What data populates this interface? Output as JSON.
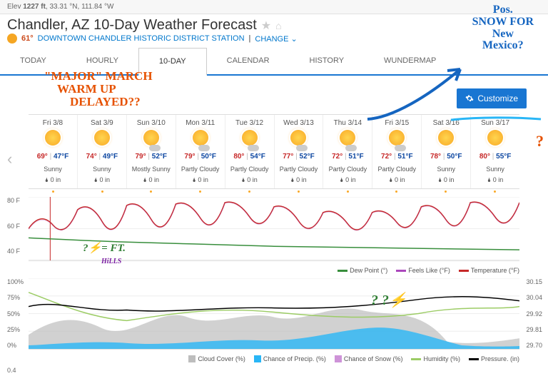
{
  "header": {
    "elev_label": "Elev",
    "elev": "1227 ft",
    "lat": "33.31 °N",
    "lon": "111.84 °W"
  },
  "title": "Chandler, AZ 10-Day Weather Forecast",
  "current": {
    "temp": "61°",
    "station": "DOWNTOWN CHANDLER HISTORIC DISTRICT STATION",
    "change": "CHANGE"
  },
  "tabs": [
    "TODAY",
    "HOURLY",
    "10-DAY",
    "CALENDAR",
    "HISTORY",
    "WUNDERMAP"
  ],
  "active_tab": 2,
  "customize": "Customize",
  "days": [
    {
      "label": "Fri 3/8",
      "hi": "69°",
      "lo": "47°F",
      "cond": "Sunny",
      "precip": "0 in",
      "cloud": false
    },
    {
      "label": "Sat 3/9",
      "hi": "74°",
      "lo": "49°F",
      "cond": "Sunny",
      "precip": "0 in",
      "cloud": false
    },
    {
      "label": "Sun 3/10",
      "hi": "79°",
      "lo": "52°F",
      "cond": "Mostly Sunny",
      "precip": "0 in",
      "cloud": true
    },
    {
      "label": "Mon 3/11",
      "hi": "79°",
      "lo": "50°F",
      "cond": "Partly Cloudy",
      "precip": "0 in",
      "cloud": true
    },
    {
      "label": "Tue 3/12",
      "hi": "80°",
      "lo": "54°F",
      "cond": "Partly Cloudy",
      "precip": "0 in",
      "cloud": true
    },
    {
      "label": "Wed 3/13",
      "hi": "77°",
      "lo": "52°F",
      "cond": "Partly Cloudy",
      "precip": "0 in",
      "cloud": true
    },
    {
      "label": "Thu 3/14",
      "hi": "72°",
      "lo": "51°F",
      "cond": "Partly Cloudy",
      "precip": "0 in",
      "cloud": true
    },
    {
      "label": "Fri 3/15",
      "hi": "72°",
      "lo": "51°F",
      "cond": "Partly Cloudy",
      "precip": "0 in",
      "cloud": true
    },
    {
      "label": "Sat 3/16",
      "hi": "78°",
      "lo": "50°F",
      "cond": "Sunny",
      "precip": "0 in",
      "cloud": false
    },
    {
      "label": "Sun 3/17",
      "hi": "80°",
      "lo": "55°F",
      "cond": "Sunny",
      "precip": "0 in",
      "cloud": false
    }
  ],
  "chart1": {
    "ylabels": [
      "80 F",
      "60 F",
      "40 F"
    ],
    "legend": [
      {
        "name": "Dew Point (°)",
        "color": "#388e3c"
      },
      {
        "name": "Feels Like (°F)",
        "color": "#ab47bc"
      },
      {
        "name": "Temperature (°F)",
        "color": "#c62828"
      }
    ]
  },
  "chart2": {
    "ylabels_left": [
      "100%",
      "75%",
      "50%",
      "25%",
      "0%"
    ],
    "ylabels_right": [
      "30.15",
      "30.04",
      "29.92",
      "29.81",
      "29.70"
    ],
    "legend": [
      {
        "name": "Cloud Cover (%)",
        "color": "#bdbdbd",
        "sq": true
      },
      {
        "name": "Chance of Precip. (%)",
        "color": "#29b6f6",
        "sq": true
      },
      {
        "name": "Chance of Snow (%)",
        "color": "#ce93d8",
        "sq": true
      },
      {
        "name": "Humidity (%)",
        "color": "#9ccc65"
      },
      {
        "name": "Pressure. (in)",
        "color": "#000"
      }
    ]
  },
  "chart3_label": "0.4",
  "annotations": {
    "orange1": "\"MAJOR\" MARCH",
    "orange2": "WARM UP",
    "orange3": "DELAYED??",
    "blue": "Pos.\nSNOW FOR\nNew\nMexico?",
    "green1": "?⚡= FT.",
    "purple1": "HiLLS",
    "green2": "? ?⚡",
    "orange_q": "?"
  },
  "chart_data": {
    "type": "line",
    "x_days": [
      "3/8",
      "3/9",
      "3/10",
      "3/11",
      "3/12",
      "3/13",
      "3/14",
      "3/15",
      "3/16",
      "3/17"
    ],
    "temperature_hi_f": [
      69,
      74,
      79,
      79,
      80,
      77,
      72,
      72,
      78,
      80
    ],
    "temperature_lo_f": [
      47,
      49,
      52,
      50,
      54,
      52,
      51,
      51,
      50,
      55
    ],
    "dew_point_f_approx": [
      41,
      40,
      40,
      39,
      39,
      38,
      38,
      36,
      35,
      34
    ],
    "humidity_pct_approx": [
      60,
      55,
      45,
      45,
      50,
      55,
      58,
      55,
      45,
      50
    ],
    "pressure_in_approx": [
      29.95,
      29.92,
      29.85,
      29.88,
      29.92,
      29.9,
      29.95,
      30.0,
      30.02,
      30.04
    ],
    "cloud_cover_pct_approx": [
      20,
      10,
      50,
      55,
      60,
      55,
      55,
      50,
      15,
      10
    ],
    "chance_precip_pct_approx": [
      5,
      0,
      5,
      10,
      15,
      15,
      25,
      25,
      5,
      0
    ]
  }
}
